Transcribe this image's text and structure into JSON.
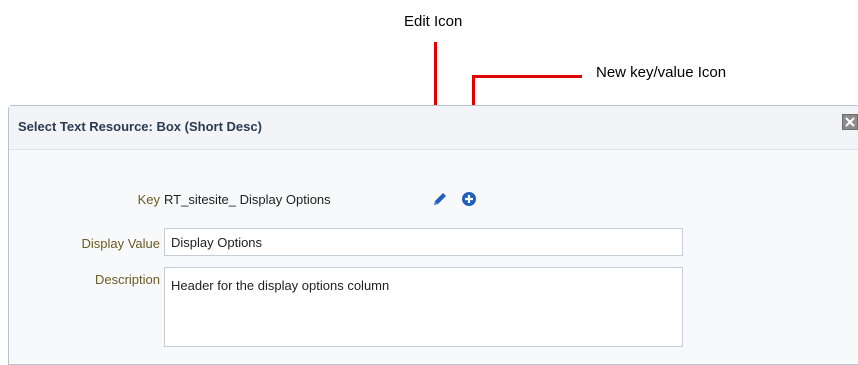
{
  "callouts": {
    "edit_icon_label": "Edit Icon",
    "new_icon_label": "New key/value Icon"
  },
  "dialog": {
    "title": "Select Text Resource: Box (Short Desc)",
    "key_label": "Key",
    "key_value": "RT_sitesite_  Display Options",
    "display_value_label": "Display Value",
    "display_value": "Display Options",
    "description_label": "Description",
    "description_value": "Header for the display options column"
  },
  "icons": {
    "edit": "pencil-icon",
    "add": "plus-circle-icon",
    "close": "close-icon"
  },
  "colors": {
    "callout_line": "#e00000",
    "icon_blue": "#1f5fbf",
    "label_text": "#6b5b22",
    "title_text": "#2b3b54"
  }
}
